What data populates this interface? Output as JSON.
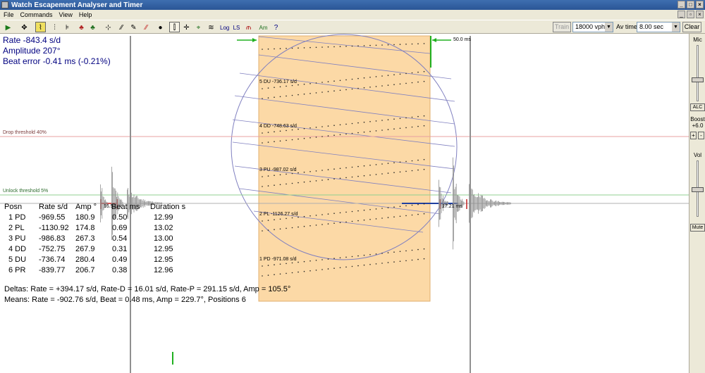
{
  "window": {
    "title": "Watch Escapement Analyser and Timer",
    "controls": [
      "_",
      "□",
      "×"
    ],
    "mdi_controls": [
      "_",
      "▫",
      "×"
    ]
  },
  "menu": [
    "File",
    "Commands",
    "View",
    "Help"
  ],
  "toolbar": {
    "icons": [
      "record-icon",
      "move-icon",
      "waveform-icon",
      "filter-icon",
      "markers-icon",
      "colors-icon",
      "crosshair-icon",
      "slope-icon",
      "pen-icon",
      "red-slope-icon",
      "pin-icon",
      "sweep-icon",
      "split-icon",
      "gauge-icon",
      "multi-icon",
      "log-label",
      "ls-label",
      "chart-icon",
      "amplitude-icon",
      "help-cursor-icon"
    ],
    "log_label": "Log",
    "ls_label": "LS",
    "am_label": "Am",
    "train_label": "Train",
    "vph_value": "18000 vph",
    "avtime_label": "Av time",
    "avtime_value": "8.00 sec",
    "clear_label": "Clear"
  },
  "readout": {
    "rate": "Rate -843.4 s/d",
    "amplitude": "Amplitude 207°",
    "beat_error": "Beat error -0.41 ms (-0.21%)"
  },
  "thresholds": {
    "drop": "Drop threshold 40%",
    "unlock": "Unlock threshold 5%"
  },
  "markers": {
    "left_ms": "16.52",
    "right_ms": "17.21 ms",
    "window_ms": "50.0 ms"
  },
  "chart_data": {
    "type": "scatter",
    "series": [
      {
        "name": "5 DU -736.17 s/d"
      },
      {
        "name": "4 DD -748.63 s/d"
      },
      {
        "name": "3 PU -987.02 s/d"
      },
      {
        "name": "2 PL -1126.27 s/d"
      },
      {
        "name": "1 PD -971.08 s/d"
      }
    ]
  },
  "table": {
    "headers": [
      "Posn",
      "Rate s/d",
      "Amp °",
      "Beat ms",
      "Duration s"
    ],
    "rows": [
      [
        "1 PD",
        "-969.55",
        "180.9",
        "0.50",
        "12.99"
      ],
      [
        "2 PL",
        "-1130.92",
        "174.8",
        "0.69",
        "13.02"
      ],
      [
        "3 PU",
        "-986.83",
        "267.3",
        "0.54",
        "13.00"
      ],
      [
        "4 DD",
        "-752.75",
        "267.9",
        "0.31",
        "12.95"
      ],
      [
        "5 DU",
        "-736.74",
        "280.4",
        "0.49",
        "12.95"
      ],
      [
        "6 PR",
        "-839.77",
        "206.7",
        "0.38",
        "12.96"
      ]
    ]
  },
  "summary": {
    "deltas": "Deltas:  Rate = +394.17 s/d, Rate-D = 16.01 s/d, Rate-P = 291.15 s/d, Amp = 105.5°",
    "means": "Means:  Rate = -902.76 s/d, Beat = 0.48 ms, Amp = 229.7°, Positions 6"
  },
  "right_panel": {
    "mic_label": "Mic",
    "alc_label": "ALC",
    "boost_label": "Boost",
    "boost_value": "+6.0",
    "plus": "+",
    "minus": "-",
    "vol_label": "Vol",
    "mute_label": "Mute"
  },
  "colors": {
    "readout_text": "#000080",
    "drop_line": "#e8a0a0",
    "unlock_line": "#90d090",
    "sample_window": "#fcd9a6",
    "circle": "#8080c0",
    "trace": "#909090"
  }
}
